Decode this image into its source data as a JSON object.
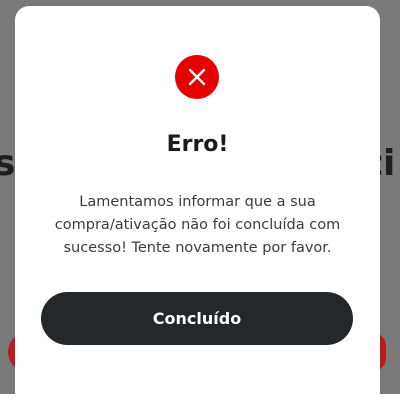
{
  "background": {
    "left_fragment": "s",
    "right_fragment": "zi"
  },
  "dialog": {
    "icon": "close-icon",
    "icon_color": "#e60000",
    "title": "Erro!",
    "message": "Lamentamos informar que a sua compra/ativação não foi concluída com sucesso! Tente novamente por favor.",
    "button_label": "Concluído",
    "button_color": "#25282b"
  }
}
